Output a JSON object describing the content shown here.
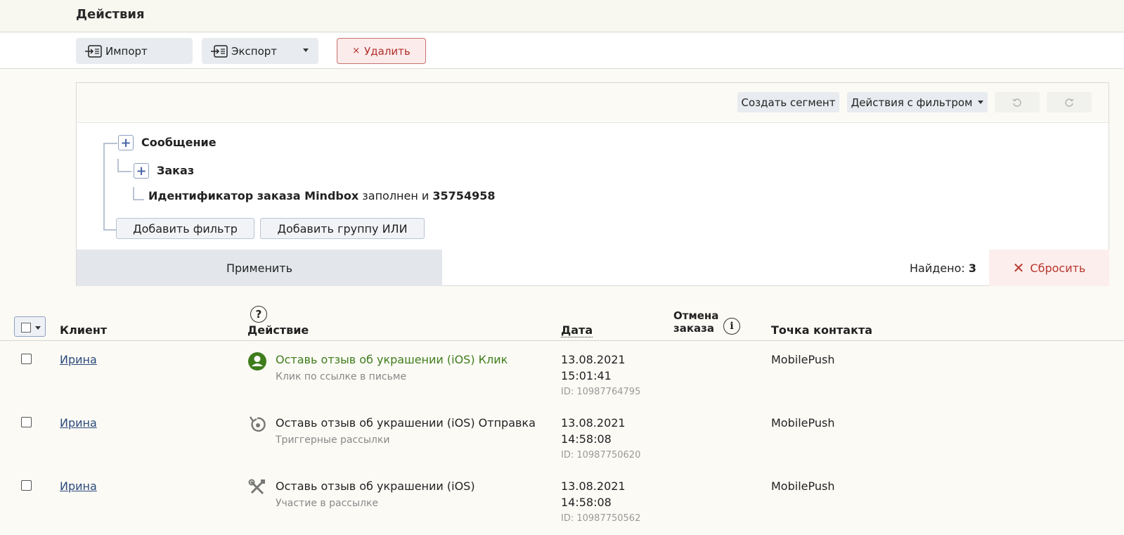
{
  "header": {
    "title": "Действия"
  },
  "toolbar": {
    "import_label": "Импорт",
    "export_label": "Экспорт",
    "delete_label": "Удалить"
  },
  "filter": {
    "create_segment_label": "Создать сегмент",
    "filter_actions_label": "Действия с фильтром",
    "group_label": "Сообщение",
    "subgroup_label": "Заказ",
    "condition": {
      "field": "Идентификатор заказа Mindbox",
      "operator": "заполнен и",
      "value": "35754958"
    },
    "add_filter_label": "Добавить фильтр",
    "add_group_label": "Добавить группу ИЛИ",
    "apply_label": "Применить",
    "found_label": "Найдено:",
    "found_count": "3",
    "reset_label": "Сбросить"
  },
  "table": {
    "columns": {
      "client": "Клиент",
      "action": "Действие",
      "date": "Дата",
      "cancel_line1": "Отмена",
      "cancel_line2": "заказа",
      "contact": "Точка контакта"
    },
    "rows": [
      {
        "client": "Ирина",
        "action": "Оставь отзыв об украшении (iOS) Клик",
        "action_sub": "Клик по ссылке в письме",
        "icon": "user-click-icon",
        "date": "13.08.2021",
        "time": "15:01:41",
        "id": "ID: 10987764795",
        "contact": "MobilePush"
      },
      {
        "client": "Ирина",
        "action": "Оставь отзыв об украшении (iOS) Отправка",
        "action_sub": "Триггерные рассылки",
        "icon": "trigger-send-icon",
        "date": "13.08.2021",
        "time": "14:58:08",
        "id": "ID: 10987750620",
        "contact": "MobilePush"
      },
      {
        "client": "Ирина",
        "action": "Оставь отзыв об украшении (iOS)",
        "action_sub": "Участие в рассылке",
        "icon": "tools-icon",
        "date": "13.08.2021",
        "time": "14:58:08",
        "id": "ID: 10987750562",
        "contact": "MobilePush"
      }
    ]
  },
  "colors": {
    "accent_green": "#3f7d1c",
    "delete_red": "#b0302a",
    "link_blue": "#2c4a7c"
  }
}
